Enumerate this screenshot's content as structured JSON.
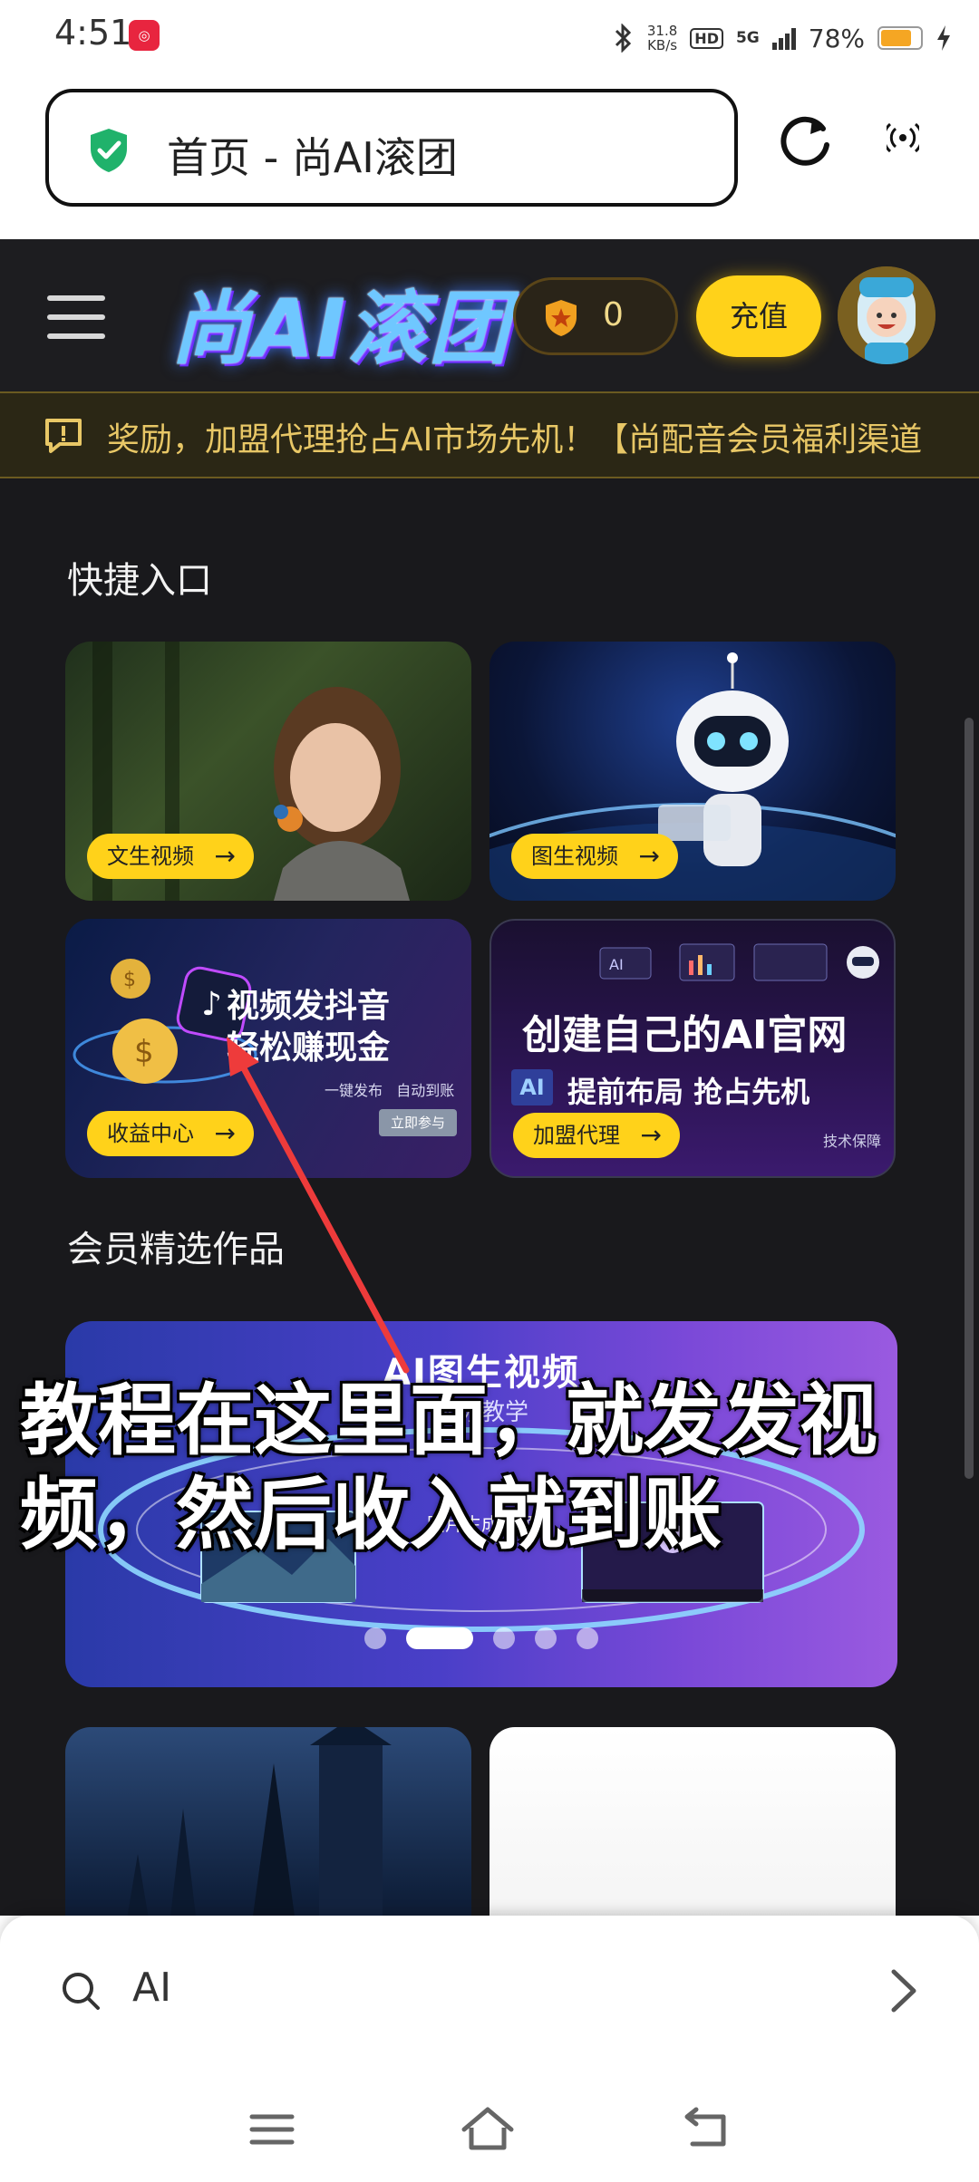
{
  "status_bar": {
    "time": "4:51",
    "net_speed_value": "31.8",
    "net_speed_unit": "KB/s",
    "hd": "HD",
    "network": "5G",
    "battery_percent": "78%",
    "battery_level": 0.78
  },
  "browser": {
    "page_title": "首页 - 尚AI滚团"
  },
  "site": {
    "logo_text": "尚AI滚团",
    "coin_balance": "0",
    "recharge_label": "充值",
    "marquee_text": "奖励，加盟代理抢占AI市场先机！【尚配音会员福利渠道"
  },
  "quick_entry": {
    "title": "快捷入口",
    "cards": [
      {
        "label": "文生视频",
        "arrow": "→"
      },
      {
        "label": "图生视频",
        "arrow": "→"
      },
      {
        "label": "收益中心",
        "arrow": "→",
        "headline1": "视频发抖音",
        "headline2": "轻松赚现金",
        "tagline": "一键发布   自动到账",
        "cta": "立即参与"
      },
      {
        "label": "加盟代理",
        "arrow": "→",
        "headline": "创建自己的AI官网",
        "badge": "AI",
        "subline": "提前布局 抢占先机",
        "note": "技术保障"
      }
    ]
  },
  "featured": {
    "title": "会员精选作品",
    "banner_title": "AI图生视频",
    "banner_subtitle": "视频教学",
    "banner_mid": "图片生成视频",
    "active_slide": 1,
    "slide_count": 5
  },
  "annotation": {
    "caption": "教程在这里面，就发发视频，然后收入就到账",
    "color": "#ee3b3b"
  },
  "bottom_bar": {
    "search_query": "AI"
  },
  "colors": {
    "accent_yellow": "#ffd21a",
    "page_bg": "#19191c",
    "secure_green": "#20b26b"
  }
}
